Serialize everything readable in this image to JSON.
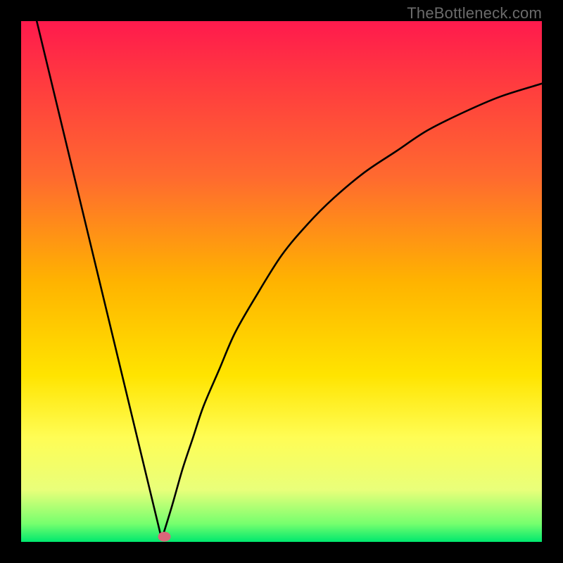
{
  "watermark": "TheBottleneck.com",
  "chart_data": {
    "type": "line",
    "title": "",
    "xlabel": "",
    "ylabel": "",
    "xlim": [
      0,
      100
    ],
    "ylim": [
      0,
      100
    ],
    "gradient_stops": [
      {
        "offset": 0.0,
        "color": "#ff1a4d"
      },
      {
        "offset": 0.12,
        "color": "#ff3b3f"
      },
      {
        "offset": 0.3,
        "color": "#ff6a2f"
      },
      {
        "offset": 0.5,
        "color": "#ffb300"
      },
      {
        "offset": 0.68,
        "color": "#ffe400"
      },
      {
        "offset": 0.8,
        "color": "#fffd55"
      },
      {
        "offset": 0.9,
        "color": "#e9ff7a"
      },
      {
        "offset": 0.965,
        "color": "#76ff6e"
      },
      {
        "offset": 1.0,
        "color": "#00e86e"
      }
    ],
    "marker": {
      "x": 27.5,
      "y": 1.0,
      "color": "#d9677a",
      "radius": 7
    },
    "series": [
      {
        "name": "left-branch",
        "x": [
          3.0,
          27.0
        ],
        "y": [
          100.0,
          0.5
        ]
      },
      {
        "name": "right-branch",
        "x": [
          27.0,
          29,
          31,
          33,
          35,
          38,
          41,
          45,
          50,
          55,
          60,
          66,
          72,
          78,
          85,
          92,
          100
        ],
        "y": [
          0.5,
          7,
          14,
          20,
          26,
          33,
          40,
          47,
          55,
          61,
          66,
          71,
          75,
          79,
          82.5,
          85.5,
          88
        ]
      }
    ]
  }
}
